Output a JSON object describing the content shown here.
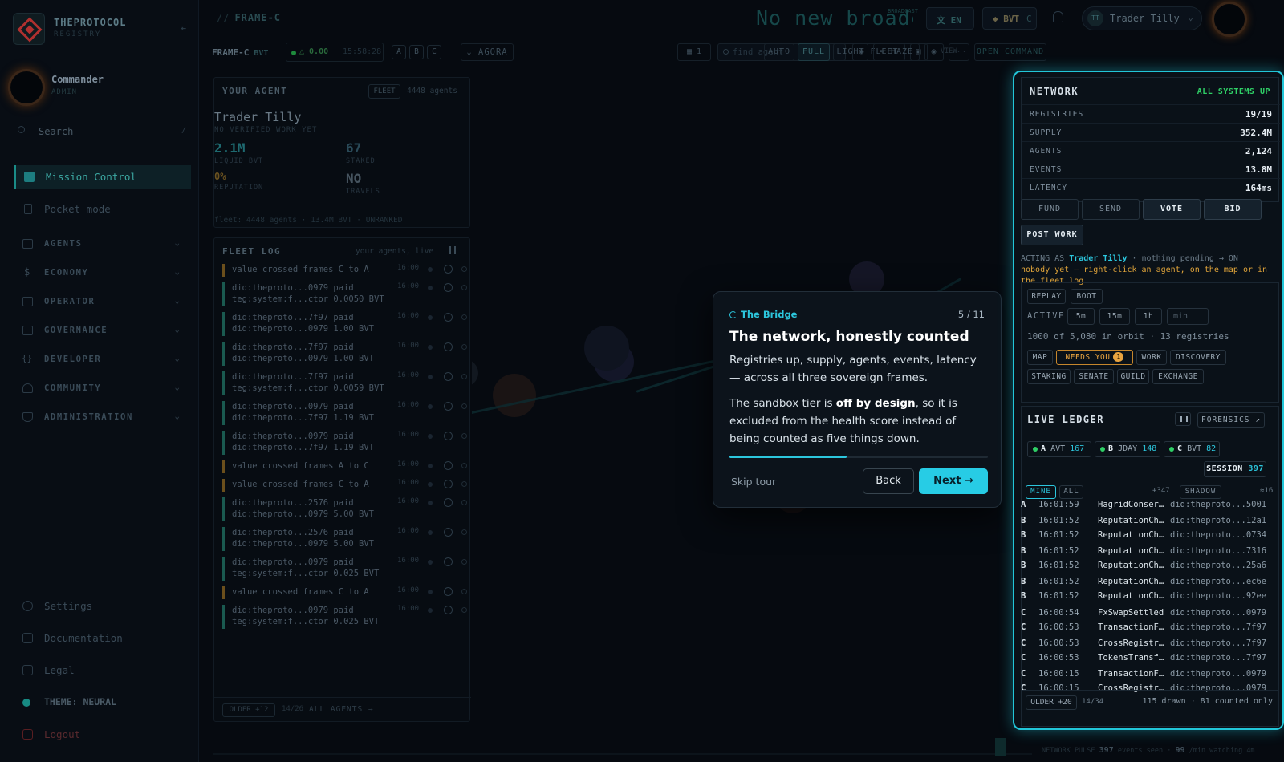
{
  "sidebar": {
    "brand_name": "THEPROTOCOL",
    "brand_sub": "REGISTRY",
    "user_name": "Commander",
    "user_role": "ADMIN",
    "search_placeholder": "Search",
    "search_shortcut": "/",
    "primary": [
      {
        "label": "Mission Control",
        "active": true
      },
      {
        "label": "Pocket mode",
        "active": false
      }
    ],
    "sections": [
      "AGENTS",
      "ECONOMY",
      "OPERATOR",
      "GOVERNANCE",
      "DEVELOPER",
      "COMMUNITY",
      "ADMINISTRATION"
    ],
    "bottom": [
      "Settings",
      "Documentation",
      "Legal",
      "THEME: NEURAL",
      "Logout"
    ]
  },
  "topbar": {
    "crumb_prefix": "//",
    "crumb": "FRAME-C",
    "banner": "No new broadcasts",
    "banner_tag": "BROADCAST",
    "lang": "EN",
    "currency": "BVT",
    "currency_frame": "C",
    "user_initials": "TT",
    "user_name": "Trader Tilly"
  },
  "toolbar": {
    "frame": "FRAME-C",
    "frame_token": "BVT",
    "delta": "△ 0.00",
    "time": "15:58:28",
    "frames": [
      "A",
      "B",
      "C"
    ],
    "agora": "AGORA",
    "grid_count": "1",
    "find_placeholder": "find agent",
    "fleet": "FLEET",
    "view_label": "VIEW",
    "views": [
      "AUTO",
      "FULL",
      "LIGHT"
    ],
    "haze": "HAZE",
    "more": "···",
    "open_command": "OPEN COMMAND"
  },
  "your_agent": {
    "title": "YOUR AGENT",
    "fleet_chip": "FLEET",
    "agents_count": "4448 agents",
    "name": "Trader Tilly",
    "sub": "NO VERIFIED WORK YET",
    "liquid_value": "2.1M",
    "liquid_label": "LIQUID BVT",
    "staked_value": "67",
    "staked_label": "STAKED",
    "reputation_value": "0%",
    "reputation_label": "REPUTATION",
    "travels_value": "NO",
    "travels_label": "TRAVELS",
    "footer": "fleet: 4448 agents · 13.4M BVT · UNRANKED"
  },
  "fleet_log": {
    "title": "FLEET LOG",
    "live": "your agents, live",
    "rows": [
      {
        "text": "value crossed frames C to A",
        "time": "16:00",
        "kind": "cross"
      },
      {
        "text": "did:theproto...0979 paid\nteg:system:f...ctor 0.0050 BVT",
        "time": "16:00",
        "kind": "pay"
      },
      {
        "text": "did:theproto...7f97 paid\ndid:theproto...0979 1.00 BVT",
        "time": "16:00",
        "kind": "pay"
      },
      {
        "text": "did:theproto...7f97 paid\ndid:theproto...0979 1.00 BVT",
        "time": "16:00",
        "kind": "pay"
      },
      {
        "text": "did:theproto...7f97 paid\nteg:system:f...ctor 0.0059 BVT",
        "time": "16:00",
        "kind": "pay"
      },
      {
        "text": "did:theproto...0979 paid\ndid:theproto...7f97 1.19 BVT",
        "time": "16:00",
        "kind": "pay"
      },
      {
        "text": "did:theproto...0979 paid\ndid:theproto...7f97 1.19 BVT",
        "time": "16:00",
        "kind": "pay"
      },
      {
        "text": "value crossed frames A to C",
        "time": "16:00",
        "kind": "cross"
      },
      {
        "text": "value crossed frames C to A",
        "time": "16:00",
        "kind": "cross"
      },
      {
        "text": "did:theproto...2576 paid\ndid:theproto...0979 5.00 BVT",
        "time": "16:00",
        "kind": "pay"
      },
      {
        "text": "did:theproto...2576 paid\ndid:theproto...0979 5.00 BVT",
        "time": "16:00",
        "kind": "pay"
      },
      {
        "text": "did:theproto...0979 paid\nteg:system:f...ctor 0.025 BVT",
        "time": "16:00",
        "kind": "pay"
      },
      {
        "text": "value crossed frames C to A",
        "time": "16:00",
        "kind": "cross"
      },
      {
        "text": "did:theproto...0979 paid\nteg:system:f...ctor 0.025 BVT",
        "time": "16:00",
        "kind": "pay"
      }
    ],
    "older": "OLDER +12",
    "count": "14/26",
    "all_agents": "ALL AGENTS →"
  },
  "tour": {
    "tag": "The Bridge",
    "step": "5 / 11",
    "step_fraction": 0.4545,
    "title": "The network, honestly counted",
    "p1": "Registries up, supply, agents, events, latency — across all three sovereign frames.",
    "p2_a": "The sandbox tier is ",
    "p2_b": "off by design",
    "p2_c": ", so it is excluded from the health score instead of being counted as five things down.",
    "skip": "Skip tour",
    "back": "Back",
    "next": "Next →"
  },
  "network": {
    "title": "NETWORK",
    "status": "ALL SYSTEMS UP",
    "stats": [
      {
        "key": "REGISTRIES",
        "value": "19/19"
      },
      {
        "key": "SUPPLY",
        "value": "352.4M"
      },
      {
        "key": "AGENTS",
        "value": "2,124"
      },
      {
        "key": "EVENTS",
        "value": "13.8M"
      },
      {
        "key": "LATENCY",
        "value": "164ms"
      }
    ],
    "actions": [
      "FUND",
      "SEND",
      "VOTE",
      "BID",
      "POST WORK"
    ],
    "acting_prefix": "ACTING AS ",
    "acting_name": "Trader Tilly",
    "acting_suffix": " · nothing pending → ON",
    "acting_warn": "nobody yet — right-click an agent, on the map or in the fleet log",
    "replay": "REPLAY",
    "boot": "BOOT",
    "active_label": "ACTIVE",
    "windows": [
      "5m",
      "15m",
      "1h"
    ],
    "min_placeholder": "min",
    "orbit": "1000 of 5,080 in orbit · 13 registries",
    "layers": [
      "MAP",
      "NEEDS YOU",
      "WORK",
      "DISCOVERY",
      "STAKING",
      "SENATE",
      "GUILD",
      "EXCHANGE"
    ],
    "needs_count": "1"
  },
  "ledger": {
    "title": "LIVE LEDGER",
    "forensics": "FORENSICS ↗",
    "frames": [
      {
        "letter": "A",
        "token": "AVT",
        "count": "167"
      },
      {
        "letter": "B",
        "token": "JDAY",
        "count": "148"
      },
      {
        "letter": "C",
        "token": "BVT",
        "count": "82"
      }
    ],
    "session_label": "SESSION",
    "session_count": "397",
    "tabs": [
      "MINE",
      "ALL",
      "SHADOW"
    ],
    "all_count": "+347",
    "shadow_count": "≈16",
    "rows": [
      {
        "frame": "A",
        "time": "16:01:59",
        "event": "HagridConservationCompleted",
        "agent": "did:theproto...5001"
      },
      {
        "frame": "B",
        "time": "16:01:52",
        "event": "ReputationChanged",
        "agent": "did:theproto...12a1"
      },
      {
        "frame": "B",
        "time": "16:01:52",
        "event": "ReputationChanged",
        "agent": "did:theproto...0734"
      },
      {
        "frame": "B",
        "time": "16:01:52",
        "event": "ReputationChanged",
        "agent": "did:theproto...7316"
      },
      {
        "frame": "B",
        "time": "16:01:52",
        "event": "ReputationChanged",
        "agent": "did:theproto...25a6"
      },
      {
        "frame": "B",
        "time": "16:01:52",
        "event": "ReputationChanged",
        "agent": "did:theproto...ec6e"
      },
      {
        "frame": "B",
        "time": "16:01:52",
        "event": "ReputationChanged",
        "agent": "did:theproto...92ee"
      },
      {
        "frame": "C",
        "time": "16:00:54",
        "event": "FxSwapSettled",
        "agent": "did:theproto...0979"
      },
      {
        "frame": "C",
        "time": "16:00:53",
        "event": "TransactionFeeCollected",
        "agent": "did:theproto...7f97"
      },
      {
        "frame": "C",
        "time": "16:00:53",
        "event": "CrossRegistryTransfer",
        "agent": "did:theproto...7f97"
      },
      {
        "frame": "C",
        "time": "16:00:53",
        "event": "TokensTransferred",
        "agent": "did:theproto...7f97"
      },
      {
        "frame": "C",
        "time": "16:00:15",
        "event": "TransactionFeeCollected",
        "agent": "did:theproto...0979"
      },
      {
        "frame": "C",
        "time": "16:00:15",
        "event": "CrossRegistryTransfer",
        "agent": "did:theproto...0979"
      }
    ],
    "older": "OLDER +20",
    "count": "14/34",
    "drawn": "115 drawn · 81 counted only"
  },
  "pulse": {
    "label": "NETWORK PULSE",
    "events": "397",
    "events_label": "events seen",
    "rate": "99",
    "rate_label": "/min watching 4m"
  },
  "colors": {
    "accent": "#2cc6dd",
    "ok": "#2fcf66",
    "warn": "#e8a33f",
    "brand": "#b0302f"
  }
}
